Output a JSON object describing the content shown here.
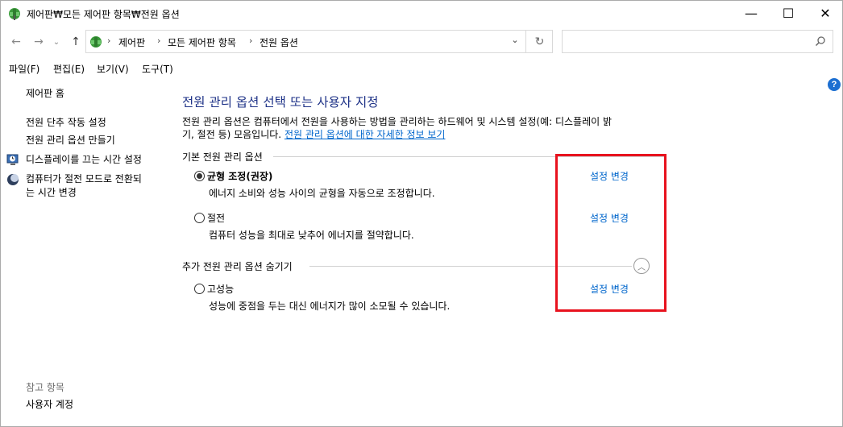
{
  "window": {
    "title": "제어판₩모든 제어판 항목₩전원 옵션",
    "minimize": "—",
    "maximize": "☐",
    "close": "✕"
  },
  "nav": {
    "back": "←",
    "forward": "→",
    "recent": "⌄",
    "up": "↑",
    "breadcrumbs": [
      "제어판",
      "모든 제어판 항목",
      "전원 옵션"
    ],
    "separator": "›",
    "dropdown": "⌄",
    "refresh": "↻",
    "search_placeholder": ""
  },
  "menu": [
    {
      "label": "파일",
      "key": "(F)"
    },
    {
      "label": "편집",
      "key": "(E)"
    },
    {
      "label": "보기",
      "key": "(V)"
    },
    {
      "label": "도구",
      "key": "(T)"
    }
  ],
  "help": "?",
  "sidebar": {
    "home": "제어판 홈",
    "links": [
      "전원 단추 작동 설정",
      "전원 관리 옵션 만들기",
      "디스플레이를 끄는 시간 설정",
      "컴퓨터가 절전 모드로 전환되",
      "는 시간 변경"
    ],
    "reference_title": "참고 항목",
    "reference_links": [
      "사용자 계정"
    ]
  },
  "main": {
    "title": "전원 관리 옵션 선택 또는 사용자 지정",
    "description_line1": "전원 관리 옵션은 컴퓨터에서 전원을 사용하는 방법을 관리하는 하드웨어 및 시스템 설정(예: 디스플레이 밝",
    "description_line2": "기, 절전 등) 모음입니다. ",
    "description_link": "전원 관리 옵션에 대한 자세한 정보 보기",
    "preferred_section": "기본 전원 관리 옵션",
    "hidden_section": "추가 전원 관리 옵션 숨기기",
    "collapse_glyph": "︿",
    "plans": [
      {
        "name": "균형 조정(권장)",
        "desc": "에너지 소비와 성능 사이의 균형을 자동으로 조정합니다.",
        "selected": true,
        "link": "설정 변경"
      },
      {
        "name": "절전",
        "desc": "컴퓨터 성능을 최대로 낮추어 에너지를 절약합니다.",
        "selected": false,
        "link": "설정 변경"
      },
      {
        "name": "고성능",
        "desc": "성능에 중점을 두는 대신 에너지가 많이 소모될 수 있습니다.",
        "selected": false,
        "link": "설정 변경"
      }
    ]
  },
  "colors": {
    "title_blue": "#1e3287",
    "link_blue": "#0066cc",
    "highlight_red": "#e8121e"
  }
}
